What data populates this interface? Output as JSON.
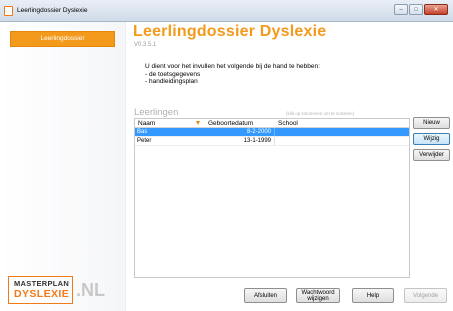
{
  "window": {
    "title": "Leerlingdossier Dyslexie",
    "minimize_label": "–",
    "maximize_label": "□",
    "close_label": "✕"
  },
  "sidebar": {
    "items": [
      {
        "label": "Leerlingdossier",
        "active": true
      }
    ]
  },
  "header": {
    "title": "Leerlingdossier Dyslexie",
    "version": "V0.3.5.1"
  },
  "intro": {
    "line1": "U dient voor het invullen het volgende bij de hand te hebben:",
    "line2": "- de toetsgegevens",
    "line3": "- handleidingsplan"
  },
  "students": {
    "title": "Leerlingen",
    "hint": "(klik op kolommen om te sorteren)",
    "columns": [
      "Naam",
      "Geboortedatum",
      "School"
    ],
    "rows": [
      {
        "name": "Bas",
        "birthdate": "8-2-2000",
        "school": "",
        "selected": true
      },
      {
        "name": "Peter",
        "birthdate": "13-1-1999",
        "school": "",
        "selected": false
      }
    ]
  },
  "actions": {
    "new_label": "Nieuw",
    "edit_label": "Wijzig",
    "delete_label": "Verwijder"
  },
  "footer": {
    "logo_line1": "MASTERPLAN",
    "logo_line2": "DYSLEXIE",
    "logo_tld": ".NL",
    "close_label": "Afsluiten",
    "password_label_line1": "Wachtwoord",
    "password_label_line2": "wijzigen",
    "help_label": "Help",
    "next_label": "Volgende"
  },
  "colors": {
    "accent": "#f39a1c",
    "selection": "#3399ff"
  }
}
